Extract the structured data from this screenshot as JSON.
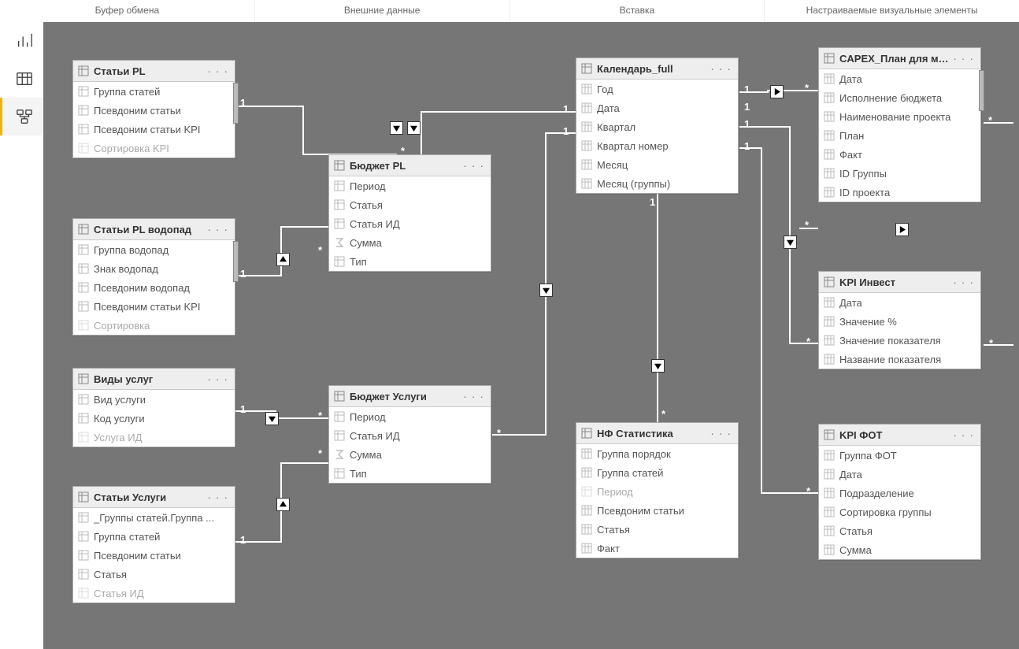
{
  "ribbon": [
    "Буфер обмена",
    "Внешние данные",
    "Вставка",
    "Настраиваемые визуальные элементы"
  ],
  "nav": {
    "report": "Report",
    "data": "Data",
    "model": "Model",
    "selected": "model"
  },
  "dots": "· · ·",
  "one": "1",
  "star": "*",
  "tables": {
    "t1": {
      "title": "Статьи PL",
      "scroll": true,
      "fields": [
        {
          "name": "Группа статей"
        },
        {
          "name": "Псевдоним статьи"
        },
        {
          "name": "Псевдоним статьи KPI"
        },
        {
          "name": "Сортировка KPI",
          "dim": true
        }
      ]
    },
    "t2": {
      "title": "Статьи PL водопад",
      "scroll": true,
      "fields": [
        {
          "name": "Группа водопад"
        },
        {
          "name": "Знак водопад"
        },
        {
          "name": "Псевдоним водопад"
        },
        {
          "name": "Псевдоним статьи KPI"
        },
        {
          "name": "Сортировка",
          "dim": true
        }
      ]
    },
    "t3": {
      "title": "Виды услуг",
      "fields": [
        {
          "name": "Вид услуги"
        },
        {
          "name": "Код услуги"
        },
        {
          "name": "Услуга ИД",
          "dim": true
        }
      ]
    },
    "t4": {
      "title": "Статьи Услуги",
      "fields": [
        {
          "name": "_Группы статей.Группа ..."
        },
        {
          "name": "Группа статей"
        },
        {
          "name": "Псевдоним статьи"
        },
        {
          "name": "Статья"
        },
        {
          "name": "Статья ИД",
          "dim": true
        }
      ]
    },
    "t5": {
      "title": "Бюджет PL",
      "fields": [
        {
          "name": "Период"
        },
        {
          "name": "Статья"
        },
        {
          "name": "Статья ИД"
        },
        {
          "name": "Сумма",
          "calc": true
        },
        {
          "name": "Тип"
        }
      ]
    },
    "t6": {
      "title": "Бюджет Услуги",
      "fields": [
        {
          "name": "Период"
        },
        {
          "name": "Статья ИД"
        },
        {
          "name": "Сумма",
          "calc": true
        },
        {
          "name": "Тип"
        }
      ]
    },
    "t7": {
      "title": "Календарь_full",
      "fields": [
        {
          "name": "Год",
          "calc": true
        },
        {
          "name": "Дата",
          "calc": true
        },
        {
          "name": "Квартал",
          "calc": true
        },
        {
          "name": "Квартал номер",
          "calc": true
        },
        {
          "name": "Месяц",
          "calc": true
        },
        {
          "name": "Месяц (группы)",
          "calc": true
        }
      ]
    },
    "t8": {
      "title": "НФ Статистика",
      "fields": [
        {
          "name": "Группа порядок",
          "calc": true
        },
        {
          "name": "Группа статей",
          "calc": true
        },
        {
          "name": "Период",
          "dim": true
        },
        {
          "name": "Псевдоним статьи",
          "calc": true
        },
        {
          "name": "Статья",
          "calc": true
        },
        {
          "name": "Факт",
          "calc": true
        }
      ]
    },
    "t9": {
      "title": "CAPEX_План для мо...",
      "scroll": true,
      "fields": [
        {
          "name": "Дата",
          "calc": true
        },
        {
          "name": "Исполнение бюджета",
          "calc": true
        },
        {
          "name": "Наименование проекта",
          "calc": true
        },
        {
          "name": "План",
          "calc": true
        },
        {
          "name": "Факт",
          "calc": true
        },
        {
          "name": "ID Группы",
          "calc": true
        },
        {
          "name": "ID проекта",
          "calc": true
        }
      ]
    },
    "t10": {
      "title": "KPI Инвест",
      "fields": [
        {
          "name": "Дата",
          "calc": true
        },
        {
          "name": "Значение %",
          "calc": true
        },
        {
          "name": "Значение показателя",
          "calc": true
        },
        {
          "name": "Название показателя",
          "calc": true
        }
      ]
    },
    "t11": {
      "title": "KPI ФОТ",
      "fields": [
        {
          "name": "Группа ФОТ",
          "calc": true
        },
        {
          "name": "Дата",
          "calc": true
        },
        {
          "name": "Подразделение",
          "calc": true
        },
        {
          "name": "Сортировка группы",
          "calc": true
        },
        {
          "name": "Статья",
          "calc": true
        },
        {
          "name": "Сумма",
          "calc": true
        }
      ]
    }
  }
}
